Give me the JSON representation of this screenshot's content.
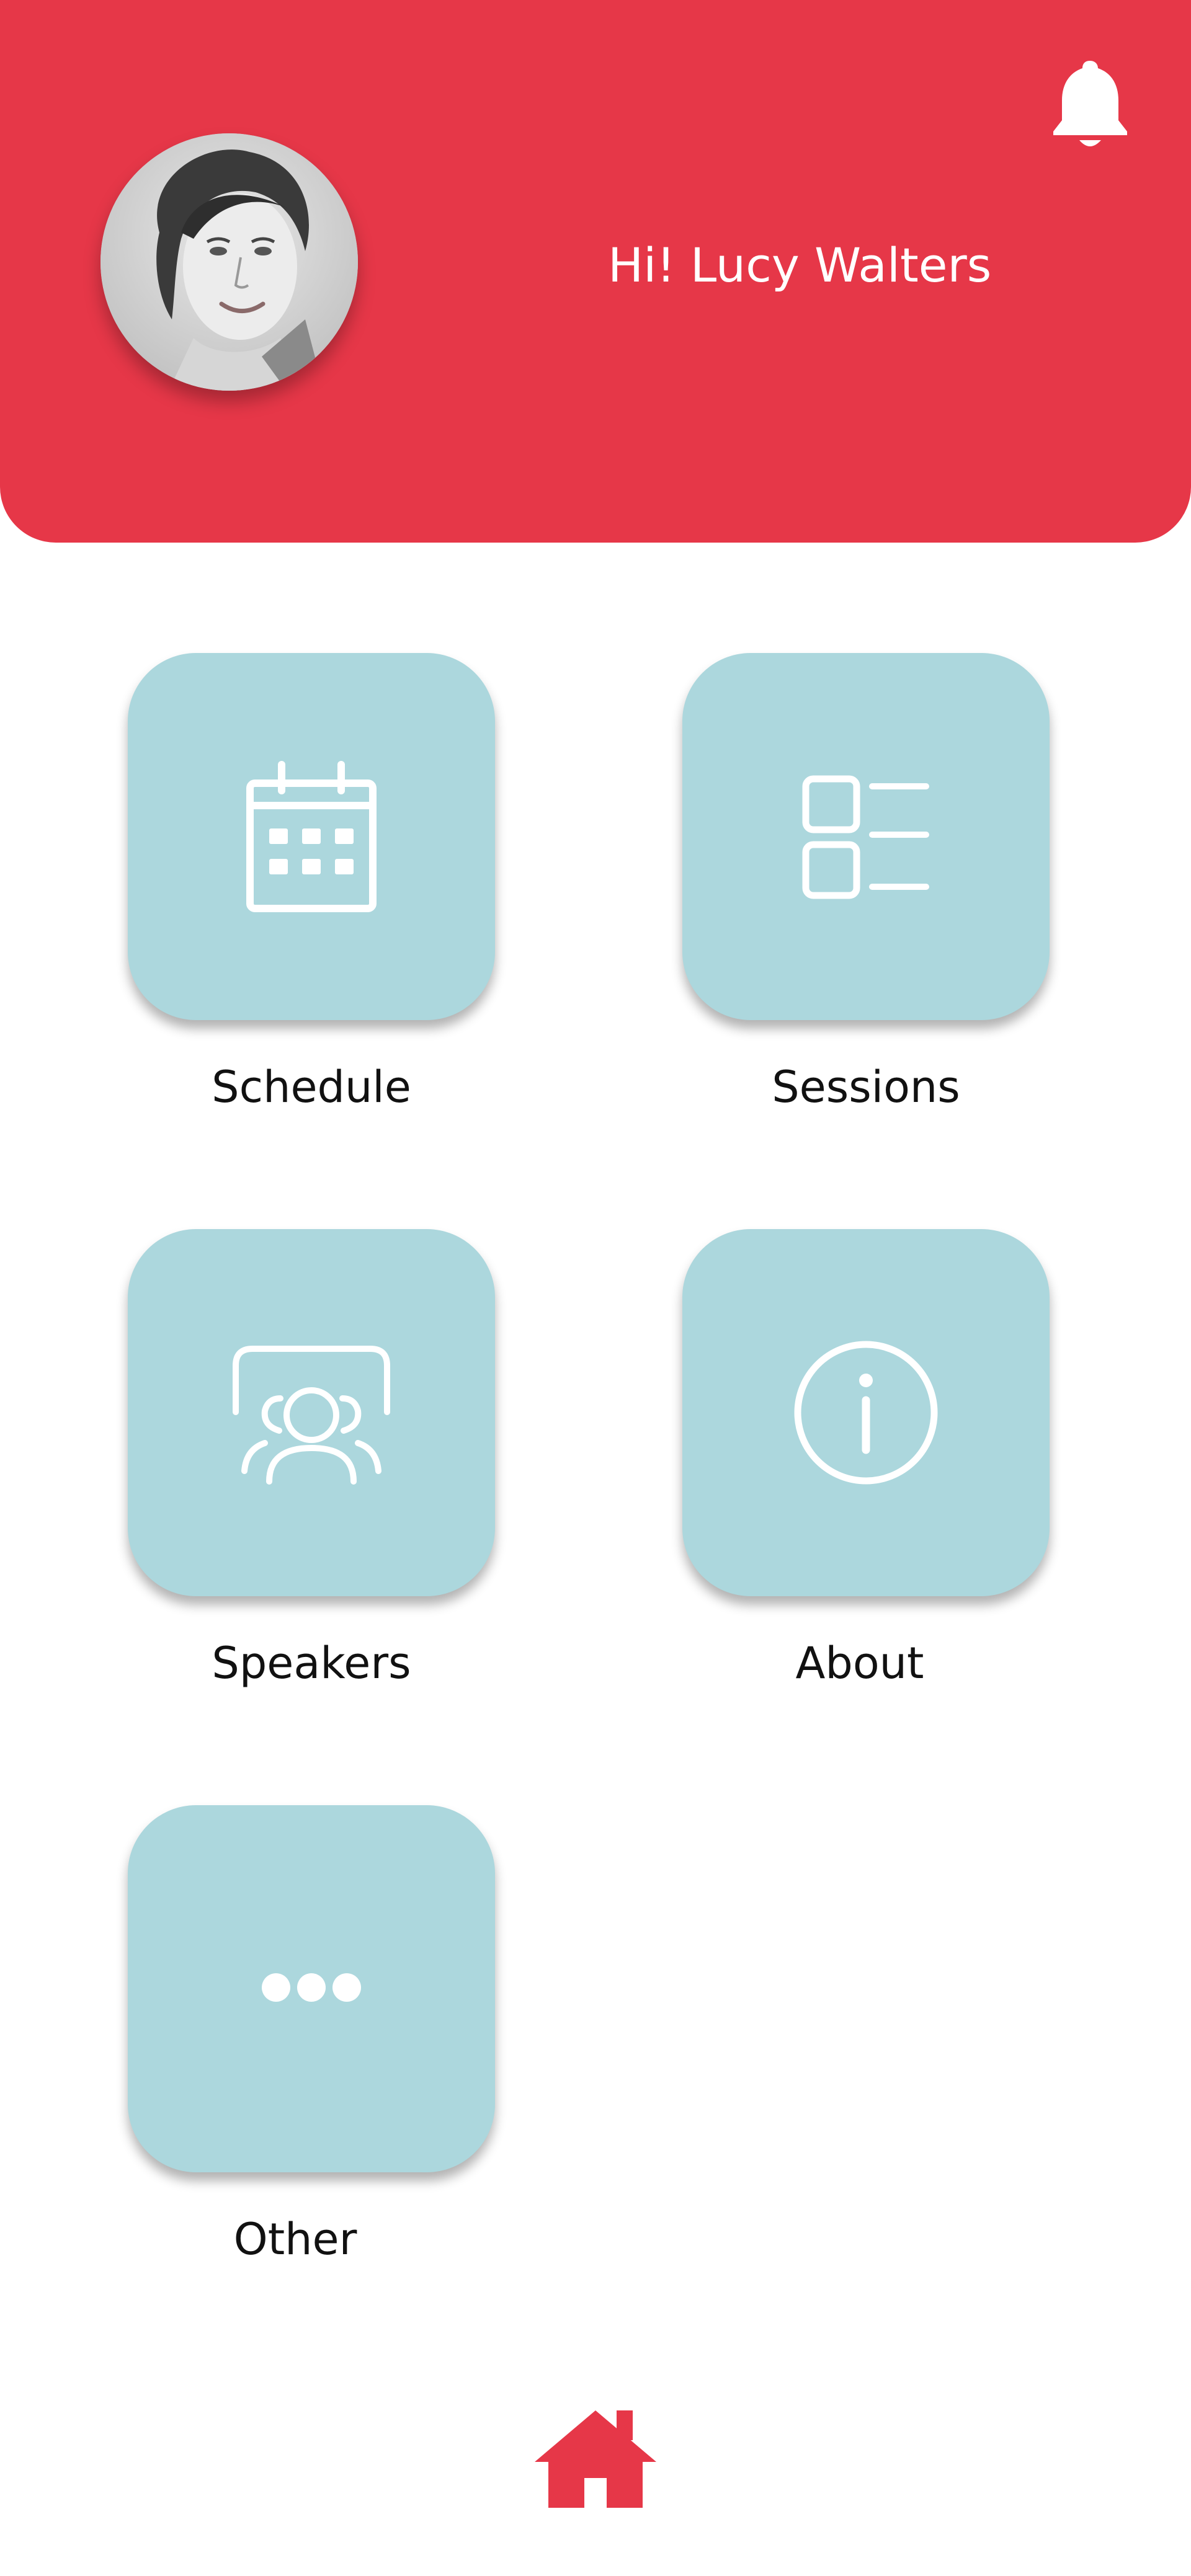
{
  "header": {
    "greeting": "Hi! Lucy Walters",
    "avatar_icon": "user-profile-photo",
    "bell_icon": "bell-icon",
    "background": "#e63748"
  },
  "menu": {
    "tiles": [
      {
        "label": "Schedule",
        "icon": "calendar-icon"
      },
      {
        "label": "Sessions",
        "icon": "list-icon"
      },
      {
        "label": "Speakers",
        "icon": "speakers-group-icon"
      },
      {
        "label": "About",
        "icon": "info-icon"
      },
      {
        "label": "Other",
        "icon": "more-dots-icon"
      }
    ],
    "tile_color": "#acd7dd"
  },
  "bottom_nav": {
    "home_icon": "home-icon",
    "accent": "#e63748"
  }
}
